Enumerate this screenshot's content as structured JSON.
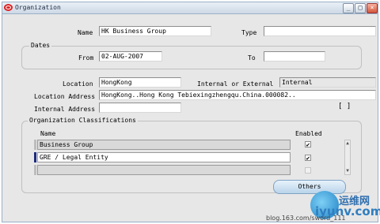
{
  "window": {
    "title": "Organization",
    "btn_minimize": "_",
    "btn_maximize": "□",
    "btn_close": "×"
  },
  "header": {
    "name_label": "Name",
    "name_value": "HK Business Group",
    "type_label": "Type",
    "type_value": ""
  },
  "dates": {
    "title": "Dates",
    "from_label": "From",
    "from_value": "02-AUG-2007",
    "to_label": "To",
    "to_value": ""
  },
  "location": {
    "location_label": "Location",
    "location_value": "HongKong",
    "int_ext_label": "Internal or External",
    "int_ext_value": "Internal",
    "address_label": "Location Address",
    "address_value": "HongKong..Hong Kong Tebiexingzhengqu.China.000082..",
    "internal_address_label": "Internal Address",
    "internal_address_value": "",
    "bracket_text": "[ ]"
  },
  "classifications": {
    "title": "Organization Classifications",
    "col_name": "Name",
    "col_enabled": "Enabled",
    "rows": [
      {
        "name": "Business Group",
        "enabled": "✔"
      },
      {
        "name": "GRE / Legal Entity",
        "enabled": "✔"
      },
      {
        "name": "",
        "enabled": ""
      }
    ],
    "others_button": "Others"
  },
  "watermark": {
    "site_cn": "运维网",
    "site": "iyunv.com",
    "blog": "blog.163.com/sword_111"
  }
}
